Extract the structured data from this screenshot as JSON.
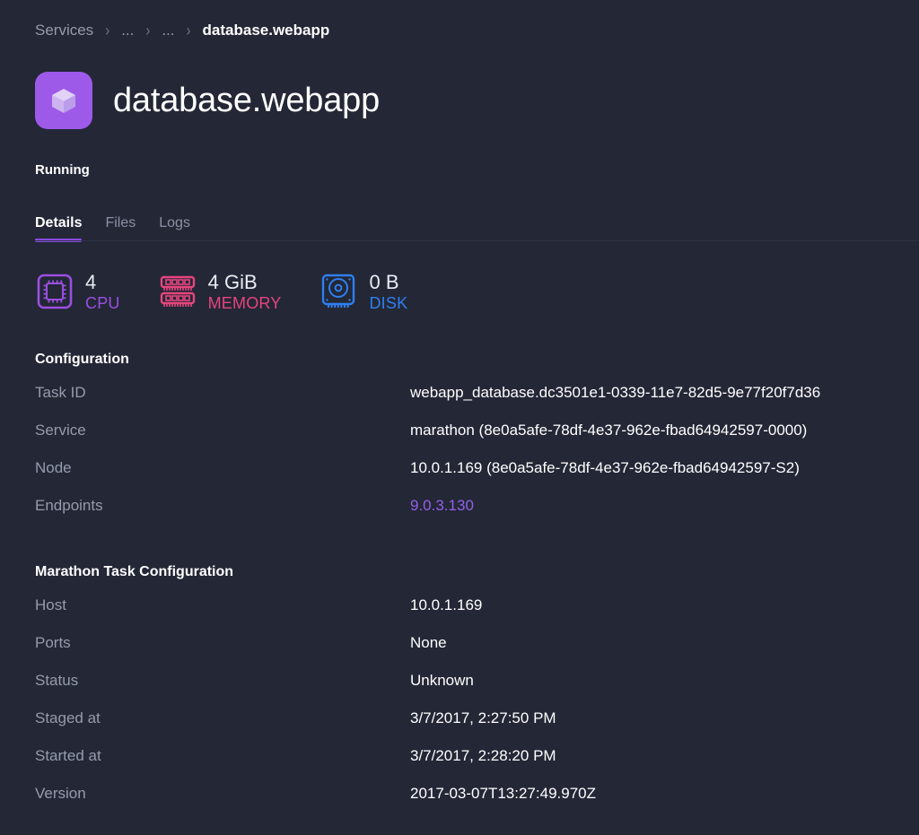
{
  "breadcrumb": {
    "items": [
      {
        "label": "Services",
        "active": false
      },
      {
        "label": "...",
        "active": false
      },
      {
        "label": "...",
        "active": false
      },
      {
        "label": "database.webapp",
        "active": true
      }
    ],
    "separator": "›"
  },
  "header": {
    "icon_name": "cube-icon",
    "title": "database.webapp",
    "status": "Running"
  },
  "tabs": [
    {
      "label": "Details",
      "active": true
    },
    {
      "label": "Files",
      "active": false
    },
    {
      "label": "Logs",
      "active": false
    }
  ],
  "stats": [
    {
      "value": "4",
      "label": "CPU",
      "icon_name": "cpu-icon",
      "color": "#9b4fe0"
    },
    {
      "value": "4 GiB",
      "label": "MEMORY",
      "icon_name": "memory-icon",
      "color": "#e8447e"
    },
    {
      "value": "0 B",
      "label": "DISK",
      "icon_name": "disk-icon",
      "color": "#2f7ff0"
    }
  ],
  "configuration": {
    "title": "Configuration",
    "rows": [
      {
        "label": "Task ID",
        "value": "webapp_database.dc3501e1-0339-11e7-82d5-9e77f20f7d36",
        "link": false
      },
      {
        "label": "Service",
        "value": "marathon (8e0a5afe-78df-4e37-962e-fbad64942597-0000)",
        "link": false
      },
      {
        "label": "Node",
        "value": "10.0.1.169 (8e0a5afe-78df-4e37-962e-fbad64942597-S2)",
        "link": false
      },
      {
        "label": "Endpoints",
        "value": "9.0.3.130",
        "link": true
      }
    ]
  },
  "marathon": {
    "title": "Marathon Task Configuration",
    "rows": [
      {
        "label": "Host",
        "value": "10.0.1.169",
        "link": false
      },
      {
        "label": "Ports",
        "value": "None",
        "link": false
      },
      {
        "label": "Status",
        "value": "Unknown",
        "link": false
      },
      {
        "label": "Staged at",
        "value": "3/7/2017, 2:27:50 PM",
        "link": false
      },
      {
        "label": "Started at",
        "value": "3/7/2017, 2:28:20 PM",
        "link": false
      },
      {
        "label": "Version",
        "value": "2017-03-07T13:27:49.970Z",
        "link": false
      }
    ]
  },
  "theme": {
    "background": "#232736",
    "accent": "#8b4ae2",
    "label_color": "#969bad",
    "link_color": "#9360e8"
  }
}
